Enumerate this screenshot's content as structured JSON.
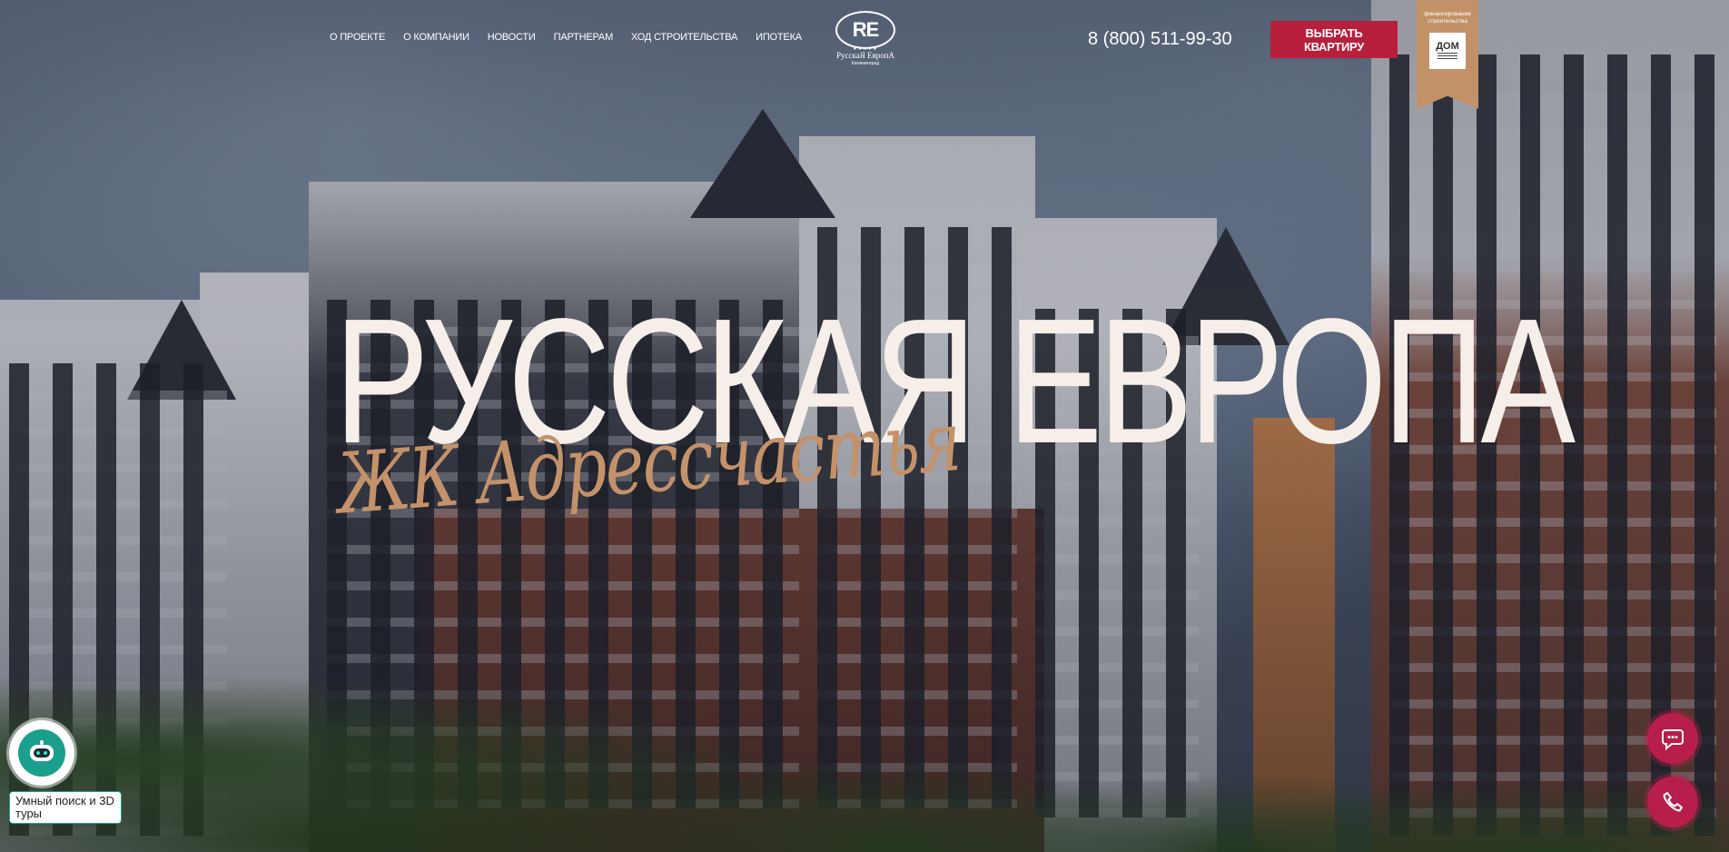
{
  "nav": {
    "items": [
      {
        "label": "О ПРОЕКТЕ"
      },
      {
        "label": "О КОМПАНИИ"
      },
      {
        "label": "НОВОСТИ"
      },
      {
        "label": "ПАРТНЕРАМ"
      },
      {
        "label": "ХОД СТРОИТЕЛЬСТВА"
      },
      {
        "label": "ИПОТЕКА"
      }
    ]
  },
  "logo": {
    "mark": "RE",
    "stars": "★★★★★",
    "name": "РусскаЯ ЕвропА",
    "city": "Калининград"
  },
  "header": {
    "phone": "8 (800) 511-99-30",
    "cta_label": "ВЫБРАТЬ КВАРТИРУ"
  },
  "ribbon": {
    "text": "финансирование строительства",
    "brand_glyph": "ДОМ"
  },
  "hero": {
    "title": "РУССКАЯ ЕВРОПА",
    "subtitle": "ЖК Адресcчастья"
  },
  "widgets": {
    "smart_search_label": "Умный поиск и 3D туры",
    "bot_icon": "robot-icon",
    "chat_icon": "chat-icon",
    "call_icon": "phone-icon"
  },
  "colors": {
    "accent": "#b71f3c",
    "title": "#f6efe9",
    "subtitle": "#c4926a",
    "ribbon": "#c39168",
    "bot": "#1aa08c"
  }
}
